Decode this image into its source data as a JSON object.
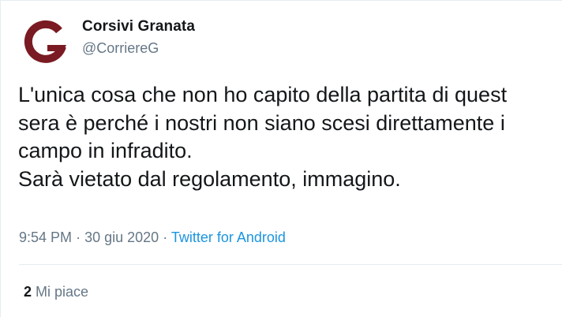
{
  "author": {
    "display_name": "Corsivi Granata",
    "handle": "@CorriereG",
    "avatar_icon": "granata-g-logo-icon",
    "brand_color": "#7a1a22"
  },
  "tweet": {
    "lines": [
      "L'unica cosa che non ho capito della partita di quest",
      "sera è perché i nostri non siano scesi direttamente i",
      "campo in infradito.",
      "Sarà vietato dal regolamento, immagino."
    ]
  },
  "meta": {
    "time": "9:54 PM",
    "separator": "·",
    "date": "30 giu 2020",
    "source": "Twitter for Android",
    "source_color": "#1b95e0"
  },
  "stats": {
    "likes_count": "2",
    "likes_label": "Mi piace"
  }
}
